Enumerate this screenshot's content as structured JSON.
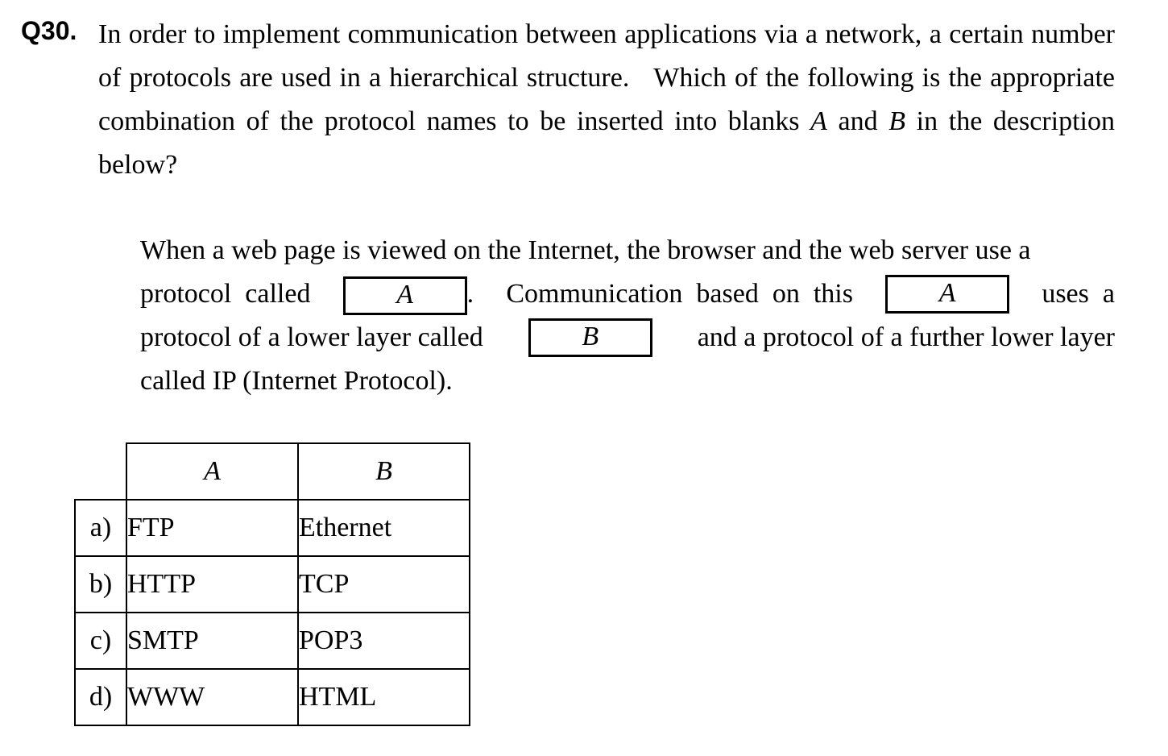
{
  "question": {
    "number": "Q30.",
    "stem": "In order to implement communication between applications via a network, a certain number of protocols are used in a hierarchical structure.  Which of the following is the appropriate combination of the protocol names to be inserted into blanks A and B in the description below?"
  },
  "passage": {
    "line1": "When a web page is viewed on the Internet, the browser and the web server use a",
    "line2_a": "protocol  called",
    "line2_b": "Communication  based  on  this",
    "line2_c": "uses  a",
    "line3_a": "protocol of a lower layer called",
    "line3_b": "and a protocol of a further lower layer",
    "line4": "called IP (Internet Protocol).",
    "blank_a": "A",
    "blank_b": "B",
    "period": "."
  },
  "answer_table": {
    "headers": [
      "A",
      "B"
    ],
    "rows": [
      {
        "label": "a)",
        "a": "FTP",
        "b": "Ethernet"
      },
      {
        "label": "b)",
        "a": "HTTP",
        "b": "TCP"
      },
      {
        "label": "c)",
        "a": "SMTP",
        "b": "POP3"
      },
      {
        "label": "d)",
        "a": "WWW",
        "b": "HTML"
      }
    ]
  }
}
